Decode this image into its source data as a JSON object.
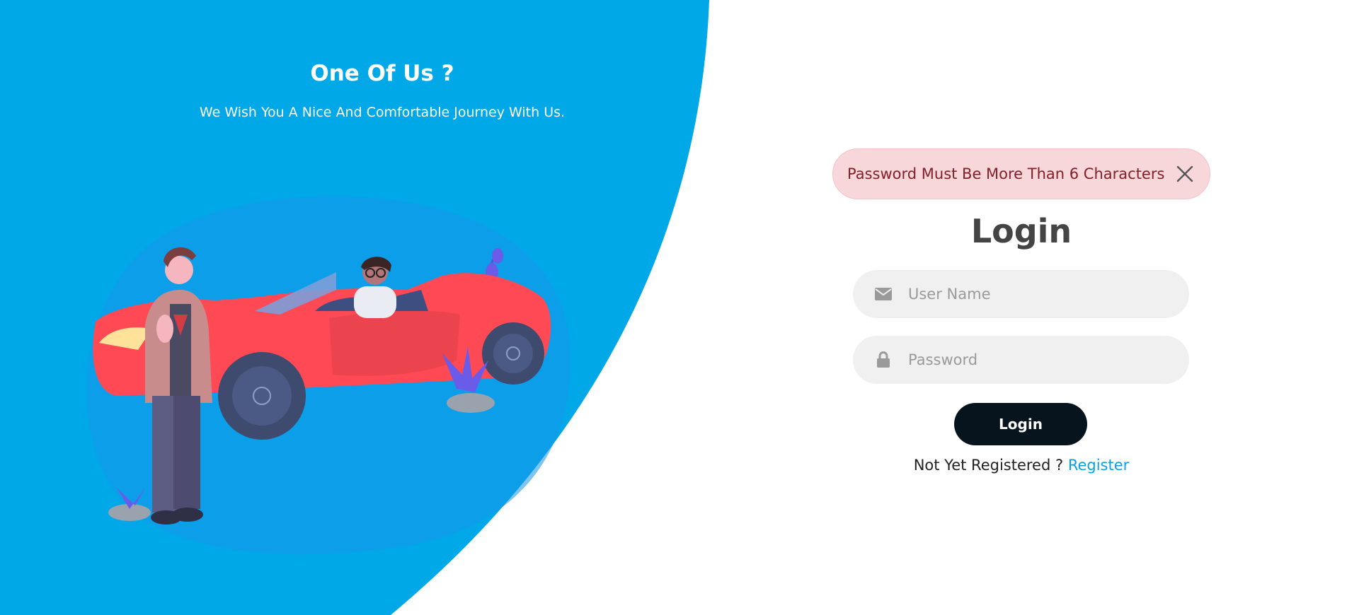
{
  "hero": {
    "title": "One Of Us ?",
    "subtitle": "We Wish You A Nice And Comfortable Journey With Us."
  },
  "alert": {
    "message": "Password Must Be More Than 6 Characters",
    "close_icon": "close-icon"
  },
  "login": {
    "title": "Login",
    "username_placeholder": "User Name",
    "password_placeholder": "Password",
    "button_label": "Login",
    "register_prompt": "Not Yet Registered ?",
    "register_link": "Register"
  },
  "icons": {
    "username": "envelope-icon",
    "password": "lock-icon"
  },
  "colors": {
    "primary_blue": "#00a8e8",
    "alert_bg": "#f8d7da",
    "alert_text": "#842029",
    "button_bg": "#07141d",
    "link": "#0aa0e6",
    "input_bg": "#f0f0f0"
  }
}
